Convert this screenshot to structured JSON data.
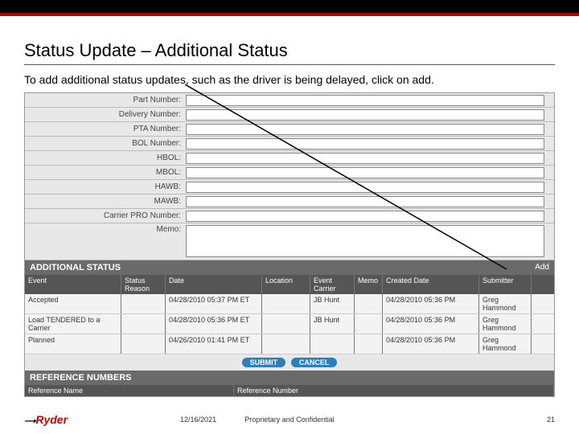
{
  "title": "Status Update – Additional Status",
  "instruction": "To add additional status updates, such as the driver is being delayed, click on add.",
  "form": {
    "part_number": "Part Number:",
    "delivery_number": "Delivery Number:",
    "pta_number": "PTA Number:",
    "bol_number": "BOL Number:",
    "hbol": "HBOL:",
    "mbol": "MBOL:",
    "hawb": "HAWB:",
    "mawb": "MAWB:",
    "carrier_pro": "Carrier PRO Number:",
    "memo": "Memo:"
  },
  "section_additional": "ADDITIONAL STATUS",
  "add_link": "Add",
  "cols": {
    "event": "Event",
    "reason": "Status Reason",
    "date": "Date",
    "location": "Location",
    "carrier": "Event Carrier",
    "memo": "Memo",
    "created": "Created Date",
    "submitter": "Submitter"
  },
  "rows": [
    {
      "event": "Accepted",
      "reason": "",
      "date": "04/28/2010 05:37 PM ET",
      "location": "",
      "carrier": "JB Hunt",
      "memo": "",
      "created": "04/28/2010 05:36 PM",
      "submitter": "Greg Hammond"
    },
    {
      "event": "Load TENDERED to a Carrier",
      "reason": "",
      "date": "04/28/2010 05:36 PM ET",
      "location": "",
      "carrier": "JB Hunt",
      "memo": "",
      "created": "04/28/2010 05:36 PM",
      "submitter": "Greg Hammond"
    },
    {
      "event": "Planned",
      "reason": "",
      "date": "04/26/2010 01:41 PM ET",
      "location": "",
      "carrier": "",
      "memo": "",
      "created": "04/28/2010 05:36 PM",
      "submitter": "Greg Hammond"
    }
  ],
  "btn_submit": "SUBMIT",
  "btn_cancel": "CANCEL",
  "section_ref": "REFERENCE NUMBERS",
  "ref_cols": {
    "name": "Reference Name",
    "number": "Reference Number"
  },
  "footer": {
    "logo": "Ryder",
    "date": "12/16/2021",
    "conf": "Proprietary and Confidential",
    "page": "21"
  }
}
